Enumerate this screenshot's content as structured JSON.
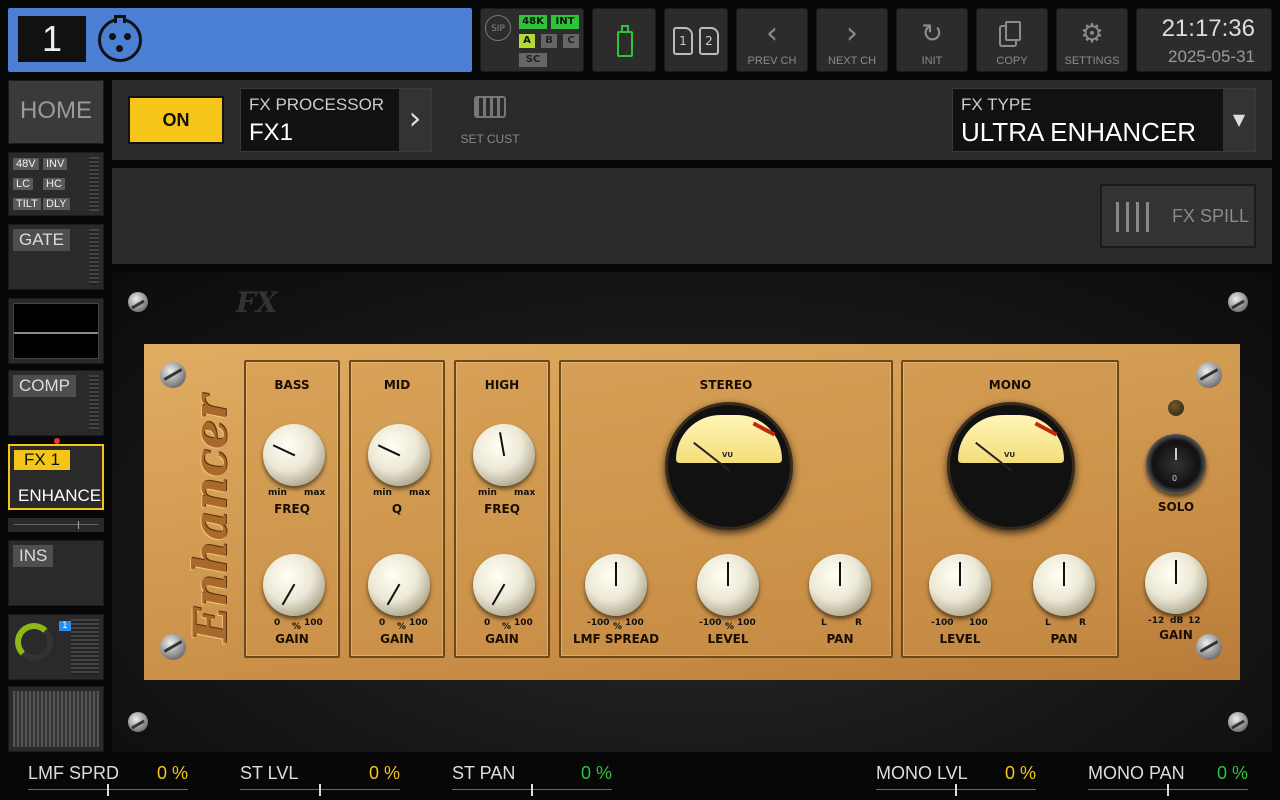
{
  "header": {
    "channel_number": "1",
    "sip": "SIP",
    "sample_rate": "48K",
    "clock": "INT",
    "scenes": [
      "A",
      "B",
      "C"
    ],
    "sc": "SC",
    "banks": [
      "1",
      "2"
    ],
    "prev_ch": "PREV CH",
    "next_ch": "NEXT CH",
    "init": "INIT",
    "copy": "COPY",
    "settings": "SETTINGS",
    "time": "21:17:36",
    "date": "2025-05-31"
  },
  "sidebar": {
    "home": "HOME",
    "eq_tags": [
      "48V",
      "INV",
      "LC",
      "HC",
      "TILT",
      "DLY"
    ],
    "gate": "GATE",
    "comp": "COMP",
    "fx": "FX 1",
    "fx_name": "ENHANCE",
    "ins": "INS",
    "bus_number": "1"
  },
  "toolbar": {
    "on_label": "ON",
    "processor_label": "FX PROCESSOR",
    "processor_value": "FX1",
    "set_cust": "SET CUST",
    "fx_type_label": "FX TYPE",
    "fx_type_value": "ULTRA ENHANCER",
    "fx_spill": "FX SPILL"
  },
  "plugin": {
    "logo": "FX",
    "brand": "Enhancer",
    "sections": {
      "bass": "BASS",
      "mid": "MID",
      "high": "HIGH",
      "stereo": "STEREO",
      "mono": "MONO"
    },
    "labels": {
      "min": "min",
      "max": "max",
      "freq": "FREQ",
      "q": "Q",
      "gain": "GAIN",
      "zero": "0",
      "pct": "%",
      "hundred": "100",
      "neg100": "-100",
      "lmf_spread": "LMF SPREAD",
      "level": "LEVEL",
      "pan": "PAN",
      "l": "L",
      "r": "R",
      "solo": "SOLO",
      "solo_zero": "0",
      "neg12": "-12",
      "db": "dB",
      "pos12": "12",
      "vu": "VU"
    }
  },
  "bottom_bar": [
    {
      "name": "LMF SPRD",
      "value": "0 %",
      "color": "#f5c518"
    },
    {
      "name": "ST LVL",
      "value": "0 %",
      "color": "#f5c518"
    },
    {
      "name": "ST PAN",
      "value": "0 %",
      "color": "#2ec43a"
    },
    {
      "name": "MONO LVL",
      "value": "0 %",
      "color": "#f5c518"
    },
    {
      "name": "MONO PAN",
      "value": "0 %",
      "color": "#2ec43a"
    }
  ],
  "colors": {
    "channel_bar": "#4a7fd4",
    "on_button": "#f5c518",
    "accent_green": "#2ec43a"
  }
}
